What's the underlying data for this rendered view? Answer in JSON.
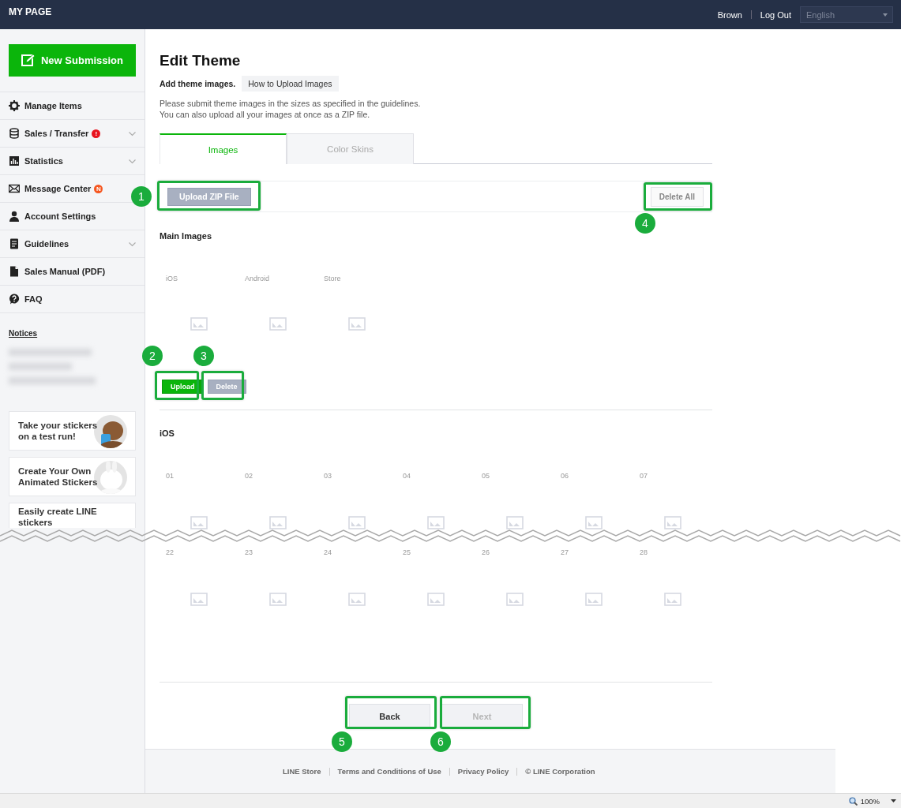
{
  "header": {
    "title": "MY PAGE",
    "user": "Brown",
    "logout": "Log Out",
    "language": "English"
  },
  "sidebar": {
    "new_submission": "New Submission",
    "items": [
      {
        "label": "Manage Items",
        "expandable": false
      },
      {
        "label": "Sales / Transfer",
        "expandable": true,
        "badge": "!",
        "color": "#e8141e"
      },
      {
        "label": "Statistics",
        "expandable": true
      },
      {
        "label": "Message Center",
        "expandable": false,
        "badge": "N",
        "color": "#f5561f"
      },
      {
        "label": "Account Settings",
        "expandable": false
      },
      {
        "label": "Guidelines",
        "expandable": true
      },
      {
        "label": "Sales Manual (PDF)",
        "expandable": false
      },
      {
        "label": "FAQ",
        "expandable": false
      }
    ],
    "notices_heading": "Notices",
    "banners": [
      {
        "lines": [
          "Take your stickers",
          "on a test run!"
        ],
        "kind": "picture"
      },
      {
        "lines": [
          "Create Your Own",
          "Animated Stickers"
        ],
        "kind": "picture"
      },
      {
        "lines": [
          "Easily create LINE",
          "stickers"
        ]
      }
    ]
  },
  "main": {
    "title": "Edit Theme",
    "intro": "Add theme images.",
    "help_button": "How to Upload Images",
    "description": [
      "Please submit theme images in the sizes as specified in the guidelines.",
      "You can also upload all your images at once as a ZIP file."
    ],
    "tabs": [
      {
        "label": "Images",
        "selected": true
      },
      {
        "label": "Color Skins",
        "selected": false
      }
    ],
    "upload_zip": {
      "label": "Upload ZIP File",
      "disabled": true
    },
    "delete_all": "Delete All",
    "main_images": {
      "heading": "Main Images",
      "slots": [
        "iOS",
        "Android",
        "Store"
      ],
      "upload": {
        "label": "Upload",
        "disabled": false
      },
      "delete": {
        "label": "Delete",
        "disabled": true
      }
    },
    "ios": {
      "heading": "iOS",
      "rows": [
        [
          "01",
          "02",
          "03",
          "04",
          "05",
          "06",
          "07"
        ],
        [
          "22",
          "23",
          "24",
          "25",
          "26",
          "27",
          "28"
        ]
      ]
    },
    "back": {
      "label": "Back",
      "disabled": false
    },
    "next": {
      "label": "Next",
      "disabled": true
    }
  },
  "annotations": [
    {
      "number": "1"
    },
    {
      "number": "4"
    },
    {
      "number": "2"
    },
    {
      "number": "3"
    },
    {
      "number": "5"
    },
    {
      "number": "6"
    }
  ],
  "footer": {
    "links": [
      "LINE Store",
      "Terms and Conditions of Use",
      "Privacy Policy",
      "© LINE Corporation"
    ]
  },
  "status_bar": {
    "zoom": "100%"
  }
}
